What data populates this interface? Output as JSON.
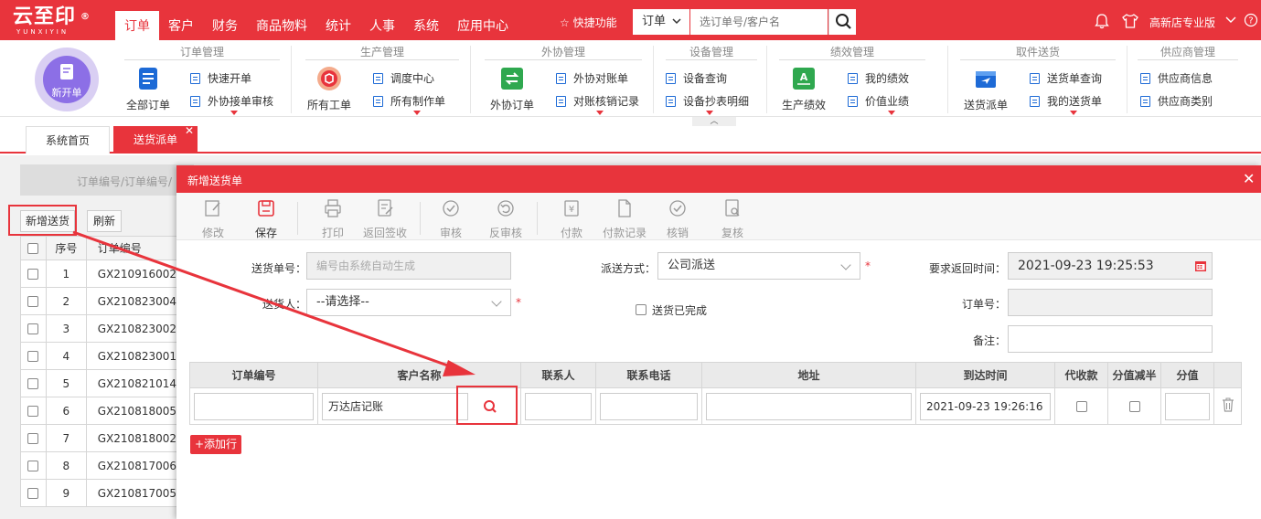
{
  "brand": {
    "logo_text": "云至印",
    "logo_reg": "®",
    "logo_sub": "YUNXIYIN"
  },
  "nav": [
    {
      "label": "订单",
      "active": true
    },
    {
      "label": "客户"
    },
    {
      "label": "财务"
    },
    {
      "label": "商品物料"
    },
    {
      "label": "统计"
    },
    {
      "label": "人事"
    },
    {
      "label": "系统"
    },
    {
      "label": "应用中心"
    }
  ],
  "quick_label": "快捷功能",
  "search": {
    "type": "订单",
    "placeholder": "选订单号/客户名"
  },
  "edition": "高新店专业版",
  "ribbon": {
    "new_order": "新开单",
    "groups": {
      "order": "订单管理",
      "production": "生产管理",
      "outsource": "外协管理",
      "equipment": "设备管理",
      "performance": "绩效管理",
      "pickup": "取件送货",
      "supplier": "供应商管理"
    },
    "items": {
      "all_orders": "全部订单",
      "quick_order": "快速开单",
      "outsource_review": "外协接单审核",
      "all_workorders": "所有工单",
      "dispatch_center": "调度中心",
      "all_production": "所有制作单",
      "outsource_orders": "外协订单",
      "outsource_statement": "外协对账单",
      "reconcile_records": "对账核销记录",
      "device_query": "设备查询",
      "meter_detail": "设备抄表明细",
      "prod_perf": "生产绩效",
      "my_perf": "我的绩效",
      "value_perf": "价值业绩",
      "delivery_dispatch": "送货派单",
      "delivery_query": "送货单查询",
      "my_delivery": "我的送货单",
      "supplier_info": "供应商信息",
      "supplier_category": "供应商类别"
    }
  },
  "tabs": {
    "home": "系统首页",
    "dispatch": "送货派单"
  },
  "bg": {
    "search_placeholder": "订单编号/订单编号/",
    "add_btn": "新增送货",
    "refresh_btn": "刷新",
    "col_no": "序号",
    "col_order": "订单编号",
    "rows": [
      {
        "no": "1",
        "order": "GX210916002"
      },
      {
        "no": "2",
        "order": "GX210823004"
      },
      {
        "no": "3",
        "order": "GX210823002"
      },
      {
        "no": "4",
        "order": "GX210823001"
      },
      {
        "no": "5",
        "order": "GX210821014"
      },
      {
        "no": "6",
        "order": "GX210818005"
      },
      {
        "no": "7",
        "order": "GX210818002"
      },
      {
        "no": "8",
        "order": "GX210817006"
      },
      {
        "no": "9",
        "order": "GX210817005"
      }
    ]
  },
  "modal": {
    "title": "新增送货单",
    "toolbar": {
      "edit": "修改",
      "save": "保存",
      "print": "打印",
      "return_sign": "返回签收",
      "audit": "审核",
      "unaudit": "反审核",
      "pay": "付款",
      "pay_record": "付款记录",
      "writeoff": "核销",
      "recheck": "复核"
    },
    "form": {
      "delivery_no_label": "送货单号：",
      "delivery_no_placeholder": "编号由系统自动生成",
      "method_label": "派送方式：",
      "method_value": "公司派送",
      "return_time_label": "要求返回时间：",
      "return_time_value": "2021-09-23 19:25:53",
      "sender_label": "送货人：",
      "sender_value": "--请选择--",
      "completed_label": "送货已完成",
      "order_no_label": "订单号：",
      "remark_label": "备注："
    },
    "table": {
      "headers": [
        "订单编号",
        "客户名称",
        "联系人",
        "联系电话",
        "地址",
        "到达时间",
        "代收款",
        "分值减半",
        "分值"
      ],
      "row": {
        "order_no": "",
        "customer": "万达店记账",
        "contact": "",
        "phone": "",
        "address": "",
        "arrive_time": "2021-09-23 19:26:16",
        "score": ""
      }
    },
    "add_row": "+添加行"
  },
  "colors": {
    "accent": "#e8343c",
    "brand_blue": "#1d6ad6",
    "new_order_purple": "#8c6fe6"
  }
}
